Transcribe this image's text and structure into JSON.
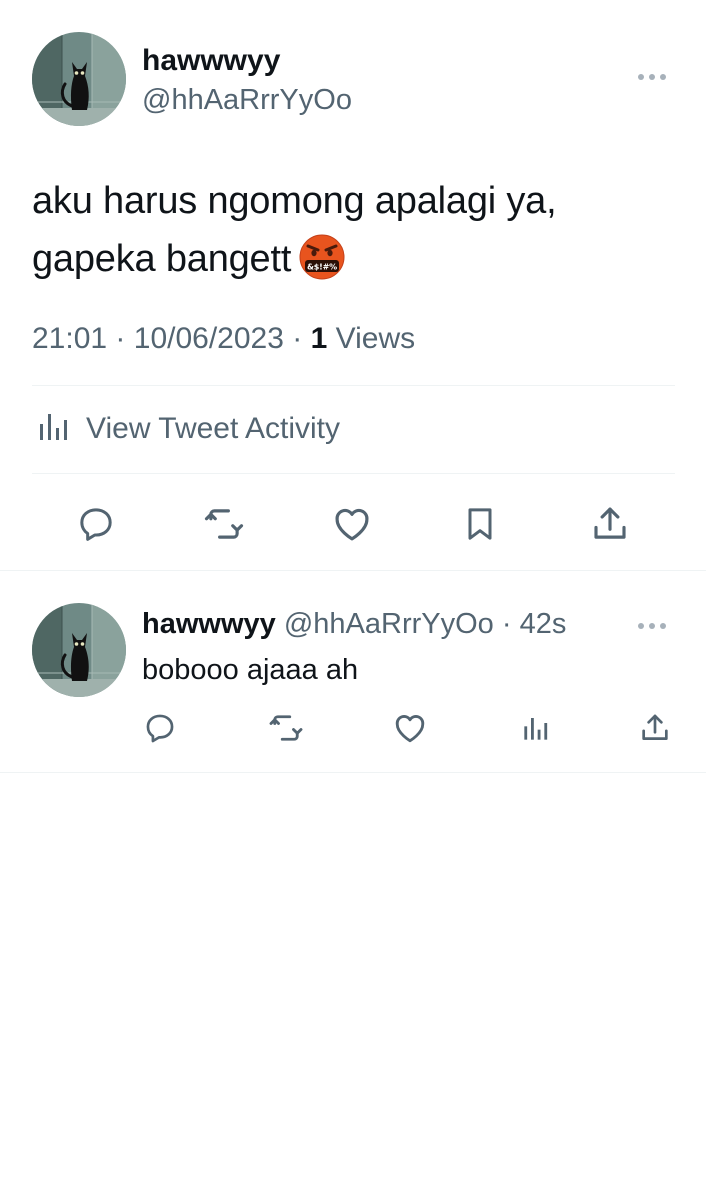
{
  "tweet": {
    "author_name": "hawwwyy",
    "author_handle": "@hhAaRrrYyOo",
    "text": "aku harus ngomong apalagi ya, gapeka bangett",
    "time": "21:01",
    "separator": "·",
    "date": "10/06/2023",
    "views_count": "1",
    "views_label": "Views",
    "activity_label": "View Tweet Activity",
    "emoji_icon": "face-with-symbols-on-mouth"
  },
  "reply": {
    "author_name": "hawwwyy",
    "author_handle": "@hhAaRrrYyOo",
    "separator": "·",
    "age": "42s",
    "text": "bobooo ajaaa ah"
  },
  "icons": {
    "main_actions": [
      "reply-icon",
      "retweet-icon",
      "like-icon",
      "bookmark-icon",
      "share-icon"
    ],
    "reply_actions": [
      "reply-icon",
      "retweet-icon",
      "like-icon",
      "analytics-icon",
      "share-icon"
    ]
  },
  "colors": {
    "text": "#0f1419",
    "secondary": "#536471",
    "divider": "#eff3f4",
    "emoji": "#e8541e"
  }
}
